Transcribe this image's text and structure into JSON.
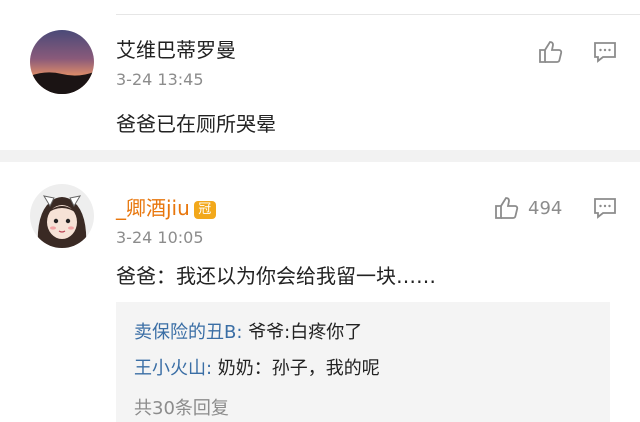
{
  "comments": [
    {
      "username": "艾维巴蒂罗曼",
      "time": "3-24 13:45",
      "text": "爸爸已在厕所哭晕",
      "likes": ""
    },
    {
      "username": "_卿酒jiu",
      "badge": "冠",
      "time": "3-24 10:05",
      "text": "爸爸：我还以为你会给我留一块……",
      "likes": "494",
      "replies": [
        {
          "user": "卖保险的丑B",
          "sep": ":",
          "text": " 爷爷:白疼你了"
        },
        {
          "user": "王小火山",
          "sep": ":",
          "text": " 奶奶：孙子，我的呢"
        },
        {
          "user": "",
          "sep": "",
          "text": "共30条回复"
        }
      ]
    }
  ],
  "icons": {
    "like": "thumbs-up-icon",
    "reply": "comment-icon"
  },
  "colors": {
    "link": "#3a6ea5",
    "vip_name": "#e8760c",
    "meta": "#8c8c8c"
  }
}
